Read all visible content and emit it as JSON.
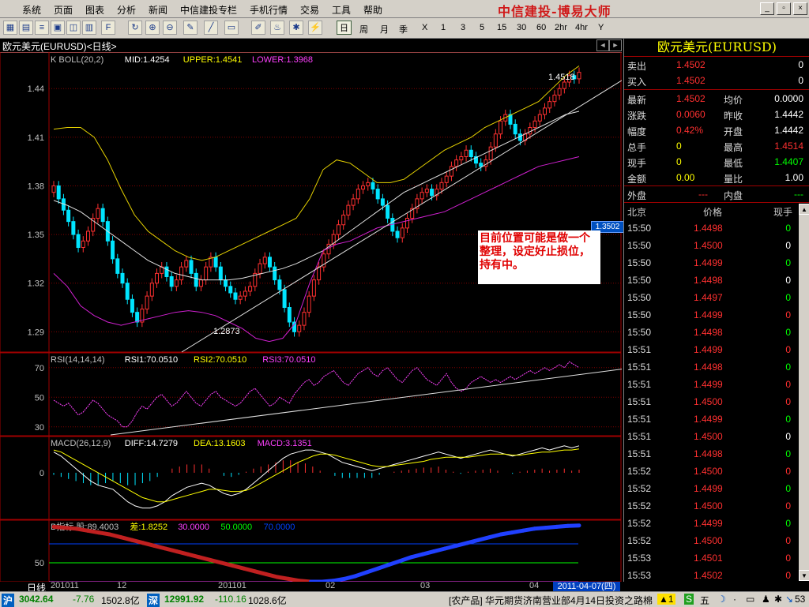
{
  "menu": [
    "系统",
    "页面",
    "图表",
    "分析",
    "新闻",
    "中信建投专栏",
    "手机行情",
    "交易",
    "工具",
    "帮助"
  ],
  "brand": "中信建投-博易大师",
  "periods": [
    "日",
    "周",
    "月",
    "季",
    "X",
    "1",
    "3",
    "5",
    "15",
    "30",
    "60",
    "2hr",
    "4hr",
    "Y"
  ],
  "window_title": "欧元美元(EURUSD)<日线>",
  "colors": {
    "up": "#ff3030",
    "down": "#00e5ff",
    "boll_mid": "#e0e0e0",
    "boll_up": "#e6d200",
    "boll_low": "#d020d0",
    "grid": "#800000",
    "yellow": "#ffff00"
  },
  "chart_data": [
    {
      "type": "candlestick",
      "title": "K BOLL(20,2)",
      "legend": [
        {
          "label": "K  BOLL(20,2)",
          "color": "#c0c0c0"
        },
        {
          "label": "MID:1.4254",
          "color": "#ffffff"
        },
        {
          "label": "UPPER:1.4541",
          "color": "#ffff00"
        },
        {
          "label": "LOWER:1.3968",
          "color": "#ff40ff"
        }
      ],
      "y_ticks": [
        "1.44",
        "1.41",
        "1.38",
        "1.35",
        "1.32",
        "1.29"
      ],
      "ylim": [
        1.2775,
        1.4625
      ],
      "price_labels": {
        "high": "1.4518",
        "low": "1.2873",
        "current": "1.3502"
      },
      "annotation": "目前位置可能是做一个整理，设定好止损位，持有中。",
      "series": [
        {
          "name": "close",
          "values": [
            1.38,
            1.372,
            1.365,
            1.358,
            1.35,
            1.342,
            1.346,
            1.352,
            1.36,
            1.366,
            1.358,
            1.346,
            1.335,
            1.326,
            1.32,
            1.31,
            1.302,
            1.296,
            1.304,
            1.312,
            1.32,
            1.326,
            1.33,
            1.324,
            1.318,
            1.322,
            1.33,
            1.334,
            1.326,
            1.318,
            1.322,
            1.33,
            1.336,
            1.33,
            1.322,
            1.318,
            1.314,
            1.31,
            1.312,
            1.315,
            1.318,
            1.326,
            1.332,
            1.336,
            1.33,
            1.322,
            1.316,
            1.305,
            1.296,
            1.29,
            1.294,
            1.302,
            1.312,
            1.322,
            1.33,
            1.338,
            1.344,
            1.35,
            1.356,
            1.362,
            1.368,
            1.372,
            1.378,
            1.38,
            1.382,
            1.378,
            1.372,
            1.368,
            1.36,
            1.352,
            1.348,
            1.354,
            1.36,
            1.366,
            1.372,
            1.376,
            1.378,
            1.374,
            1.378,
            1.382,
            1.386,
            1.392,
            1.396,
            1.398,
            1.402,
            1.398,
            1.394,
            1.392,
            1.396,
            1.404,
            1.412,
            1.42,
            1.424,
            1.418,
            1.412,
            1.408,
            1.412,
            1.416,
            1.42,
            1.424,
            1.428,
            1.432,
            1.436,
            1.44,
            1.444,
            1.448,
            1.446,
            1.45
          ]
        },
        {
          "name": "MID",
          "values": [
            1.371,
            1.368,
            1.364,
            1.358,
            1.352,
            1.346,
            1.34,
            1.334,
            1.33,
            1.326,
            1.324,
            1.322,
            1.322,
            1.322,
            1.323,
            1.325,
            1.327,
            1.329,
            1.332,
            1.336,
            1.34,
            1.346,
            1.352,
            1.358,
            1.364,
            1.37,
            1.376,
            1.38,
            1.384,
            1.388,
            1.392,
            1.396,
            1.4,
            1.404,
            1.408,
            1.412,
            1.416,
            1.42,
            1.424,
            1.426
          ]
        },
        {
          "name": "UPPER",
          "values": [
            1.415,
            1.416,
            1.416,
            1.41,
            1.396,
            1.378,
            1.362,
            1.352,
            1.346,
            1.34,
            1.336,
            1.334,
            1.336,
            1.34,
            1.344,
            1.348,
            1.352,
            1.356,
            1.36,
            1.372,
            1.39,
            1.396,
            1.394,
            1.388,
            1.382,
            1.382,
            1.384,
            1.39,
            1.396,
            1.402,
            1.406,
            1.41,
            1.416,
            1.42,
            1.424,
            1.428,
            1.432,
            1.44,
            1.448,
            1.454
          ]
        },
        {
          "name": "LOWER",
          "values": [
            1.326,
            1.318,
            1.306,
            1.3,
            1.296,
            1.294,
            1.296,
            1.298,
            1.3,
            1.302,
            1.303,
            1.302,
            1.3,
            1.296,
            1.292,
            1.286,
            1.284,
            1.286,
            1.296,
            1.32,
            1.34,
            1.344,
            1.346,
            1.35,
            1.354,
            1.356,
            1.358,
            1.36,
            1.362,
            1.364,
            1.368,
            1.372,
            1.376,
            1.38,
            1.384,
            1.388,
            1.392,
            1.394,
            1.396,
            1.398
          ]
        }
      ]
    },
    {
      "type": "line",
      "title": "RSI(14,14,14)",
      "legend": [
        {
          "label": "RSI(14,14,14)",
          "color": "#c0c0c0"
        },
        {
          "label": "RSI1:70.0510",
          "color": "#ffffff"
        },
        {
          "label": "RSI2:70.0510",
          "color": "#ffff00"
        },
        {
          "label": "RSI3:70.0510",
          "color": "#ff40ff"
        }
      ],
      "y_ticks": [
        "70",
        "50",
        "30"
      ],
      "ylim": [
        24,
        80
      ],
      "series": [
        {
          "name": "RSI1",
          "values": [
            48,
            46,
            44,
            46,
            42,
            38,
            40,
            44,
            48,
            46,
            42,
            38,
            36,
            34,
            30,
            30,
            34,
            40,
            44,
            42,
            46,
            50,
            52,
            48,
            44,
            46,
            50,
            54,
            50,
            46,
            44,
            48,
            52,
            54,
            50,
            48,
            46,
            44,
            46,
            50,
            54,
            56,
            52,
            48,
            44,
            46,
            50,
            48,
            46,
            52,
            56,
            60,
            62,
            58,
            60,
            64,
            66,
            68,
            64,
            60,
            58,
            62,
            66,
            68,
            70,
            66,
            64,
            68,
            70,
            66,
            62,
            60,
            64,
            68,
            70,
            66,
            62,
            60,
            58,
            62,
            66,
            60,
            56,
            54,
            56,
            60,
            62,
            64,
            62,
            60,
            62,
            60,
            62,
            64,
            62,
            64,
            66,
            68,
            66,
            68,
            70,
            68,
            70,
            72,
            70,
            74,
            72,
            70
          ]
        }
      ]
    },
    {
      "type": "line",
      "title": "MACD(26,12,9)",
      "legend": [
        {
          "label": "MACD(26,12,9)",
          "color": "#c0c0c0"
        },
        {
          "label": "DIFF:14.7279",
          "color": "#ffffff"
        },
        {
          "label": "DEA:13.1603",
          "color": "#ffff00"
        },
        {
          "label": "MACD:3.1351",
          "color": "#ff40ff"
        }
      ],
      "y_ticks": [
        "0"
      ],
      "ylim": [
        -45,
        35
      ],
      "series": [
        {
          "name": "DIFF",
          "values": [
            20,
            16,
            10,
            4,
            -2,
            -8,
            -12,
            -14,
            -16,
            -22,
            -28,
            -32,
            -34,
            -34,
            -32,
            -28,
            -22,
            -18,
            -14,
            -12,
            -10,
            -12,
            -16,
            -20,
            -22,
            -20,
            -16,
            -10,
            -4,
            2,
            8,
            14,
            18,
            20,
            22,
            22,
            20,
            18,
            14,
            10,
            8,
            6,
            4,
            2,
            4,
            6,
            8,
            10,
            12,
            14,
            16,
            18,
            20,
            18,
            16,
            14,
            16,
            18,
            20,
            22,
            20,
            18,
            16,
            18,
            20,
            22,
            24,
            22,
            24,
            26,
            24,
            26
          ]
        },
        {
          "name": "DEA",
          "values": [
            22,
            20,
            16,
            12,
            8,
            4,
            0,
            -4,
            -8,
            -12,
            -16,
            -20,
            -24,
            -26,
            -28,
            -28,
            -26,
            -24,
            -22,
            -20,
            -18,
            -16,
            -16,
            -17,
            -18,
            -18,
            -17,
            -14,
            -10,
            -6,
            -2,
            2,
            6,
            10,
            13,
            16,
            18,
            18,
            17,
            15,
            13,
            11,
            9,
            7,
            6,
            6,
            7,
            8,
            9,
            10,
            11,
            13,
            14,
            15,
            15,
            15,
            15,
            16,
            17,
            18,
            18,
            18,
            17,
            17,
            18,
            19,
            20,
            20,
            21,
            22,
            22,
            23
          ]
        },
        {
          "name": "MACD",
          "values": [
            -2,
            -4,
            -6,
            -8,
            -10,
            -12,
            -12,
            -10,
            -8,
            -10,
            -12,
            -12,
            -10,
            -8,
            -4,
            0,
            4,
            6,
            8,
            8,
            8,
            4,
            0,
            -3,
            -4,
            -2,
            1,
            4,
            6,
            8,
            10,
            12,
            12,
            10,
            9,
            6,
            2,
            0,
            -3,
            -5,
            -5,
            -5,
            -5,
            -5,
            -2,
            0,
            1,
            2,
            3,
            4,
            5,
            5,
            6,
            3,
            1,
            -1,
            1,
            2,
            3,
            4,
            2,
            0,
            -1,
            1,
            2,
            3,
            4,
            2,
            3,
            4,
            2,
            3
          ]
        }
      ]
    },
    {
      "type": "line",
      "title": "B指标",
      "legend": [
        {
          "label": "B指标  股:89.4003",
          "color": "#c0c0c0"
        },
        {
          "label": "差:1.8252",
          "color": "#ffff00"
        },
        {
          "label": "30.0000",
          "color": "#ff40ff"
        },
        {
          "label": "50.0000",
          "color": "#00ff00"
        },
        {
          "label": "70.0000",
          "color": "#0040ff"
        }
      ],
      "y_ticks": [
        "50"
      ],
      "ylim": [
        30,
        95
      ],
      "levels": [
        30,
        50,
        70
      ],
      "series": [
        {
          "name": "股",
          "values": [
            88,
            87,
            86,
            84,
            82,
            80,
            77,
            74,
            71,
            68,
            65,
            62,
            59,
            56,
            53,
            50,
            47,
            44,
            41,
            38,
            35,
            33,
            31,
            30,
            30,
            31,
            33,
            36,
            40,
            44,
            48,
            52,
            56,
            59,
            62,
            65,
            68,
            71,
            74,
            77,
            80,
            82,
            84,
            86,
            87,
            88,
            89,
            89.4
          ]
        }
      ]
    }
  ],
  "x_axis": {
    "label": "日线",
    "ticks": [
      "201011",
      "12",
      "201101",
      "02",
      "03",
      "04"
    ],
    "date_box": "2011-04-07(四)"
  },
  "quote": {
    "title": "欧元美元(EURUSD)",
    "ask_label": "卖出",
    "ask": "1.4502",
    "ask_vol": "0",
    "bid_label": "买入",
    "bid": "1.4502",
    "bid_vol": "0",
    "stats": [
      {
        "l1": "最新",
        "v1": "1.4502",
        "l2": "均价",
        "v2": "0.0000",
        "c1": "#ff3030",
        "c2": "#ffffff"
      },
      {
        "l1": "涨跌",
        "v1": "0.0060",
        "l2": "昨收",
        "v2": "1.4442",
        "c1": "#ff3030",
        "c2": "#ffffff"
      },
      {
        "l1": "幅度",
        "v1": "0.42%",
        "l2": "开盘",
        "v2": "1.4442",
        "c1": "#ff3030",
        "c2": "#ffffff"
      },
      {
        "l1": "总手",
        "v1": "0",
        "l2": "最高",
        "v2": "1.4514",
        "c1": "#ffff00",
        "c2": "#ff3030"
      },
      {
        "l1": "现手",
        "v1": "0",
        "l2": "最低",
        "v2": "1.4407",
        "c1": "#ffff00",
        "c2": "#00ff00"
      },
      {
        "l1": "金额",
        "v1": "0.00",
        "l2": "量比",
        "v2": "1.00",
        "c1": "#ffff00",
        "c2": "#ffffff"
      }
    ],
    "outer_label": "外盘",
    "outer": "---",
    "inner_label": "内盘",
    "inner": "---",
    "ticks_header": [
      "北京",
      "价格",
      "现手"
    ],
    "ticks": [
      {
        "t": "15:50",
        "p": "1.4498",
        "v": "0",
        "vc": "#00ff00"
      },
      {
        "t": "15:50",
        "p": "1.4500",
        "v": "0",
        "vc": "#ffffff"
      },
      {
        "t": "15:50",
        "p": "1.4499",
        "v": "0",
        "vc": "#00ff00"
      },
      {
        "t": "15:50",
        "p": "1.4498",
        "v": "0",
        "vc": "#ffffff"
      },
      {
        "t": "15:50",
        "p": "1.4497",
        "v": "0",
        "vc": "#00ff00"
      },
      {
        "t": "15:50",
        "p": "1.4499",
        "v": "0",
        "vc": "#ff3030"
      },
      {
        "t": "15:50",
        "p": "1.4498",
        "v": "0",
        "vc": "#00ff00"
      },
      {
        "t": "15:51",
        "p": "1.4499",
        "v": "0",
        "vc": "#ff3030"
      },
      {
        "t": "15:51",
        "p": "1.4498",
        "v": "0",
        "vc": "#00ff00"
      },
      {
        "t": "15:51",
        "p": "1.4499",
        "v": "0",
        "vc": "#ff3030"
      },
      {
        "t": "15:51",
        "p": "1.4500",
        "v": "0",
        "vc": "#ff3030"
      },
      {
        "t": "15:51",
        "p": "1.4499",
        "v": "0",
        "vc": "#00ff00"
      },
      {
        "t": "15:51",
        "p": "1.4500",
        "v": "0",
        "vc": "#ffffff"
      },
      {
        "t": "15:51",
        "p": "1.4498",
        "v": "0",
        "vc": "#00ff00"
      },
      {
        "t": "15:52",
        "p": "1.4500",
        "v": "0",
        "vc": "#ff3030"
      },
      {
        "t": "15:52",
        "p": "1.4499",
        "v": "0",
        "vc": "#00ff00"
      },
      {
        "t": "15:52",
        "p": "1.4500",
        "v": "0",
        "vc": "#ff3030"
      },
      {
        "t": "15:52",
        "p": "1.4499",
        "v": "0",
        "vc": "#00ff00"
      },
      {
        "t": "15:52",
        "p": "1.4500",
        "v": "0",
        "vc": "#ff3030"
      },
      {
        "t": "15:53",
        "p": "1.4501",
        "v": "0",
        "vc": "#ff3030"
      },
      {
        "t": "15:53",
        "p": "1.4502",
        "v": "0",
        "vc": "#ff3030"
      }
    ]
  },
  "status": {
    "sh_label": "沪",
    "sh_index": "3042.64",
    "sh_chg": "-7.76",
    "sh_amt": "1502.8亿",
    "sz_label": "深",
    "sz_index": "12991.92",
    "sz_chg": "-110.16",
    "sz_amt": "1028.6亿",
    "ticker": "[农产品] 华元期货济南营业部4月14日投资之路棉",
    "alert": "▲1",
    "five": "五",
    "count": "53"
  }
}
